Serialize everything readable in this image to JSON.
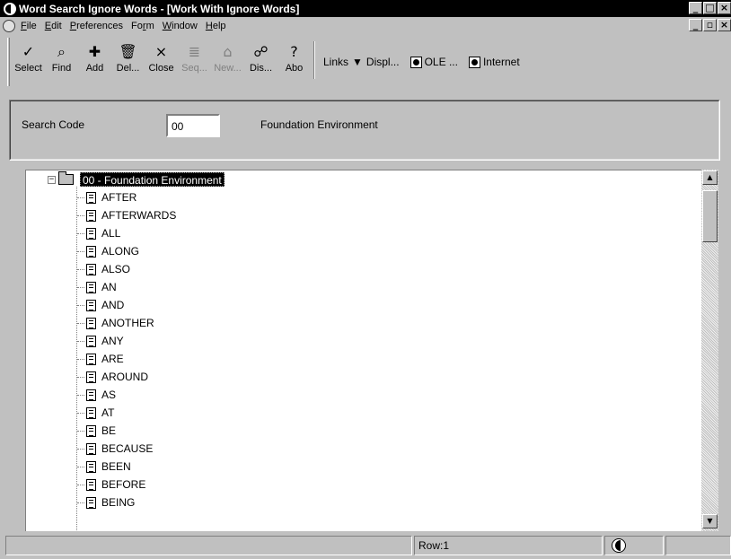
{
  "window": {
    "title": "Word Search Ignore Words - [Work With Ignore Words]"
  },
  "menu": {
    "items": [
      {
        "label": "File",
        "ul": "F",
        "rest": "ile"
      },
      {
        "label": "Edit",
        "ul": "E",
        "rest": "dit"
      },
      {
        "label": "Preferences",
        "ul": "P",
        "rest": "references"
      },
      {
        "label": "Form",
        "pre": "Fo",
        "ul": "r",
        "rest": "m"
      },
      {
        "label": "Window",
        "ul": "W",
        "rest": "indow"
      },
      {
        "label": "Help",
        "ul": "H",
        "rest": "elp"
      }
    ]
  },
  "toolbar": {
    "buttons": [
      {
        "label": "Select",
        "icon": "check-icon",
        "glyph": "✓",
        "disabled": false
      },
      {
        "label": "Find",
        "icon": "find-icon",
        "glyph": "⌕",
        "disabled": false
      },
      {
        "label": "Add",
        "icon": "add-icon",
        "glyph": "✚",
        "disabled": false
      },
      {
        "label": "Del...",
        "icon": "trash-icon",
        "glyph": "🗑",
        "disabled": false
      },
      {
        "label": "Close",
        "icon": "close-icon",
        "glyph": "×",
        "disabled": false
      },
      {
        "label": "Seq...",
        "icon": "sequence-icon",
        "glyph": "≣",
        "disabled": true
      },
      {
        "label": "New...",
        "icon": "new-icon",
        "glyph": "⌂",
        "disabled": true
      },
      {
        "label": "Dis...",
        "icon": "display-icon",
        "glyph": "☍",
        "disabled": false
      },
      {
        "label": "Abo",
        "icon": "about-icon",
        "glyph": "?",
        "disabled": false
      }
    ],
    "links_label": "Links",
    "display_label": "Displ...",
    "ole_label": "OLE ...",
    "internet_label": "Internet"
  },
  "header": {
    "search_code_label": "Search Code",
    "search_code_value": "00",
    "search_code_description": "Foundation Environment"
  },
  "tree": {
    "root_label": "00 - Foundation Environment",
    "items": [
      "AFTER",
      "AFTERWARDS",
      "ALL",
      "ALONG",
      "ALSO",
      "AN",
      "AND",
      "ANOTHER",
      "ANY",
      "ARE",
      "AROUND",
      "AS",
      "AT",
      "BE",
      "BECAUSE",
      "BEEN",
      "BEFORE",
      "BEING"
    ]
  },
  "status": {
    "row_text": "Row:1"
  }
}
